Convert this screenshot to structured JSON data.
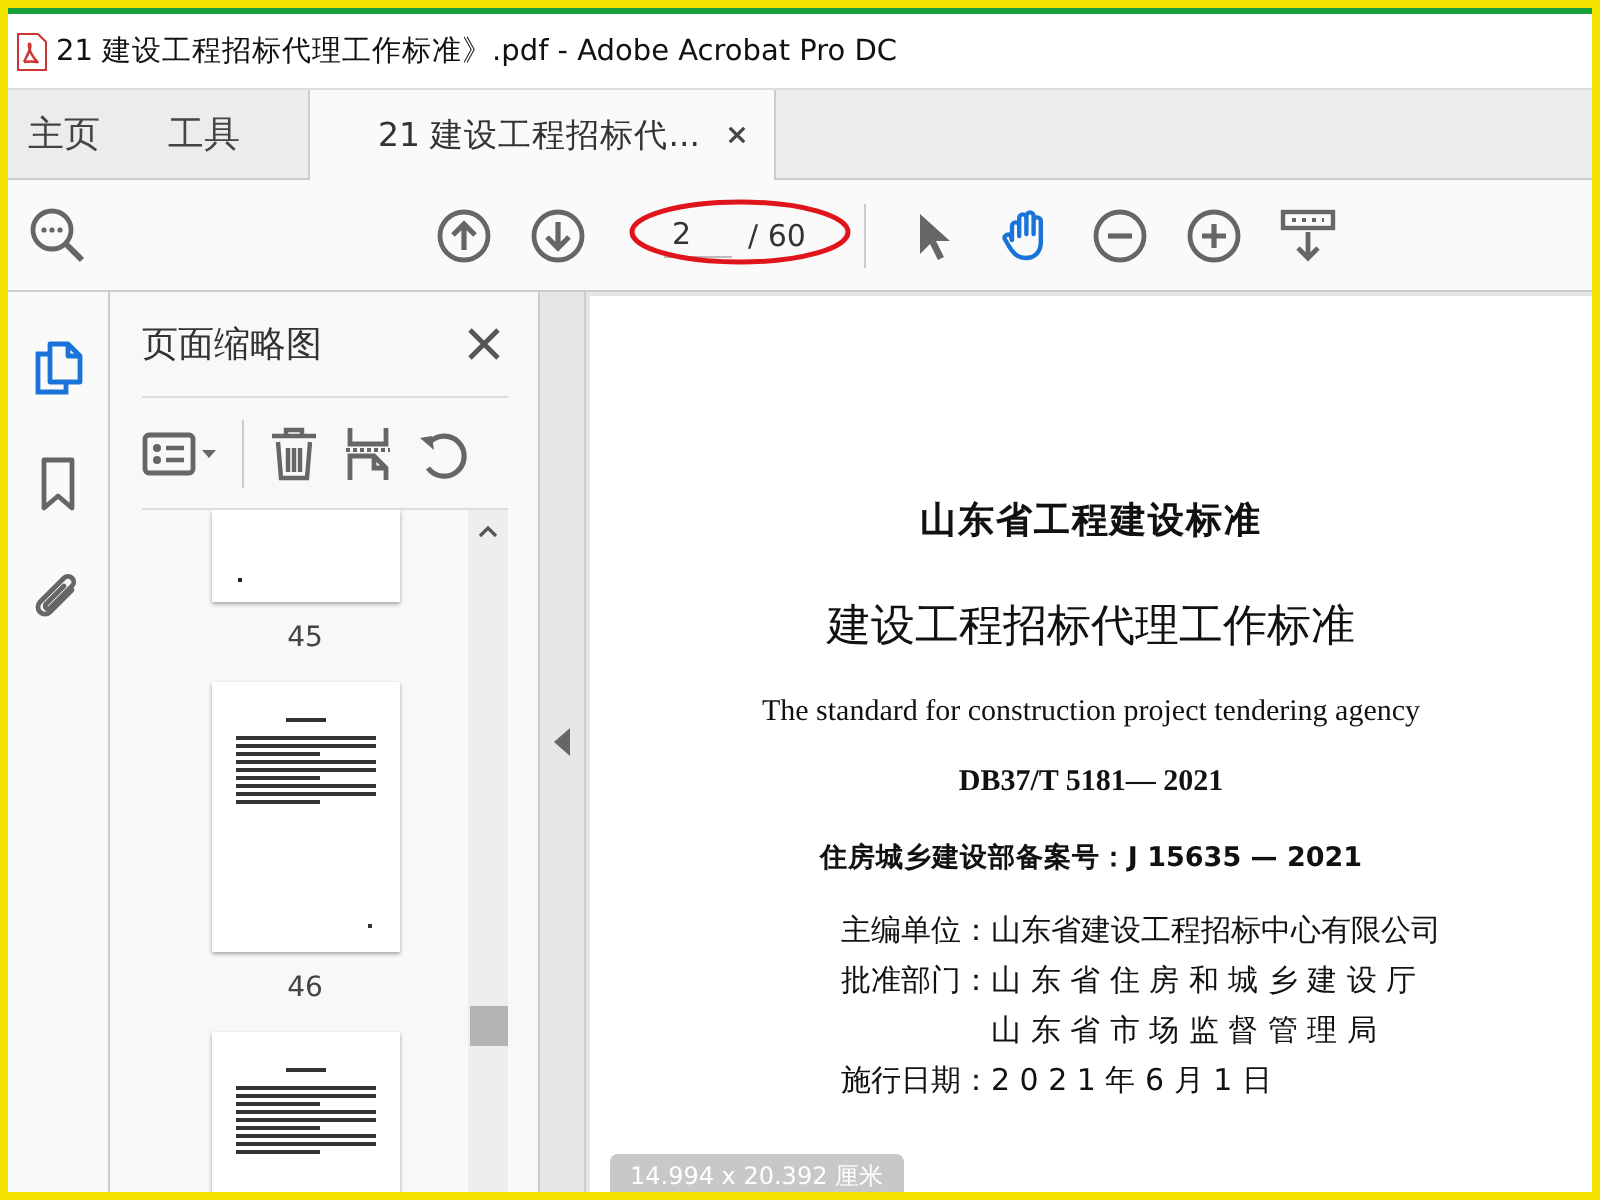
{
  "window": {
    "title": "21 建设工程招标代理工作标准》.pdf - Adobe Acrobat Pro DC"
  },
  "tabs": [
    {
      "label": "主页",
      "selected": false,
      "kind": "nav"
    },
    {
      "label": "工具",
      "selected": false,
      "kind": "nav"
    },
    {
      "label": "21 建设工程招标代...",
      "selected": true,
      "kind": "document"
    }
  ],
  "toolbar": {
    "page_field": {
      "value": "2",
      "total": "/ 60"
    },
    "tools": [
      {
        "kind": "select",
        "selected": false
      },
      {
        "kind": "hand",
        "selected": true
      }
    ]
  },
  "rail": [
    {
      "kind": "pages",
      "selected": true
    },
    {
      "kind": "bookmark",
      "selected": false
    },
    {
      "kind": "attachment",
      "selected": false
    }
  ],
  "thumbnails_panel": {
    "title": "页面缩略图",
    "thumbnails": [
      {
        "kind": "blank",
        "page_label": "45"
      },
      {
        "kind": "text",
        "page_label": "46"
      },
      {
        "kind": "text"
      }
    ]
  },
  "document": {
    "heading": "山东省工程建设标准",
    "title": "建设工程招标代理工作标准",
    "english_title": "The standard for construction project tendering agency",
    "code": "DB37/T 5181— 2021",
    "record": "住房城乡建设部备案号：J 15635 — 2021",
    "details": [
      {
        "label": "主编单位：",
        "values": [
          "山东省建设工程招标中心有限公司"
        ]
      },
      {
        "label": "批准部门：",
        "values": [
          "山 东 省 住 房 和 城 乡 建 设 厅",
          "山 东 省 市 场 监 督 管 理 局"
        ]
      },
      {
        "label": "施行日期：",
        "values": [
          "2 0 2 1 年 6 月 1 日"
        ]
      }
    ]
  },
  "tooltip": "14.994 x 20.392 厘米"
}
